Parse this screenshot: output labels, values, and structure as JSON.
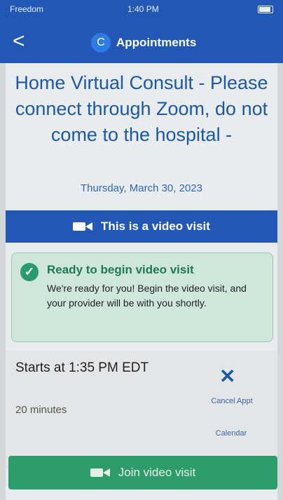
{
  "status_bar": {
    "carrier": "Freedom",
    "time": "1:40 PM"
  },
  "header": {
    "avatar_letter": "C",
    "title": "Appointments",
    "back_glyph": "<"
  },
  "appointment": {
    "title": "Home Virtual Consult - Please connect through Zoom, do not come to the hospital -",
    "date": "Thursday, March 30, 2023",
    "video_banner": "This is a video visit"
  },
  "ready": {
    "title": "Ready to begin video visit",
    "body": "We're ready for you! Begin the video visit, and your provider will be with you shortly."
  },
  "details": {
    "starts": "Starts at 1:35 PM EDT",
    "duration": "20 minutes",
    "cancel_label": "Cancel Appt",
    "calendar_label": "Calendar"
  },
  "join_button": {
    "label": "Join video visit"
  },
  "icons": {
    "back": "chevron-left-icon",
    "video": "video-camera-icon",
    "check": "checkmark-icon",
    "cancel": "close-icon"
  },
  "colors": {
    "header": "#2257b5",
    "accent_green": "#2e9b6a",
    "ready_bg": "#cfe6dd",
    "text_blue": "#1b58a7"
  }
}
